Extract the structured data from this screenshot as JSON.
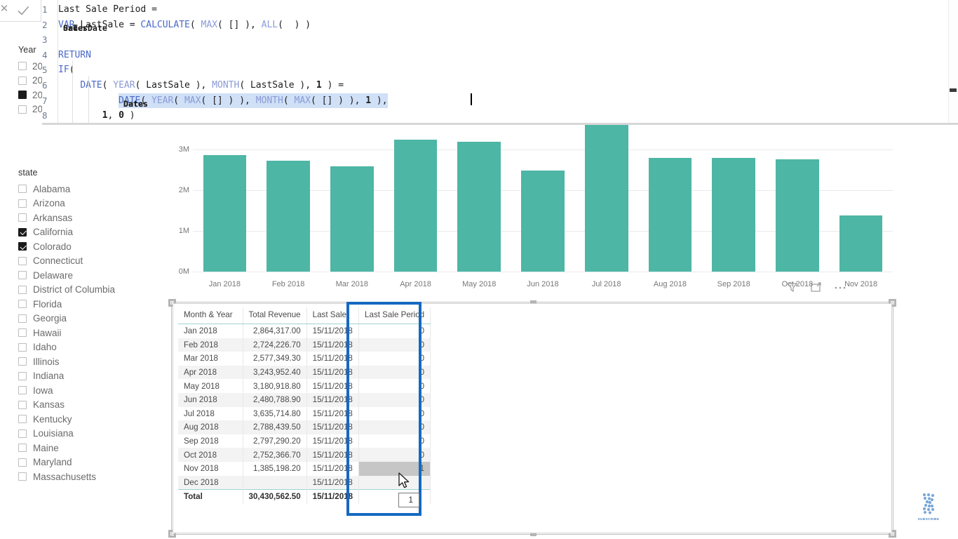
{
  "app": {
    "name": "Power BI Desktop",
    "accent_teal": "#4DB6A5",
    "annotation_blue": "#1669c1"
  },
  "formula_bar": {
    "cancel_icon": "x-icon",
    "commit_icon": "checkmark-icon",
    "measure_name": "Last Sale Period",
    "lines": [
      {
        "n": "1",
        "text": "Last Sale Period ="
      },
      {
        "n": "2",
        "text": "VAR LastSale = CALCULATE( MAX( Sales[OrderDate] ), ALL( Sales ) )"
      },
      {
        "n": "3",
        "text": ""
      },
      {
        "n": "4",
        "text": "RETURN"
      },
      {
        "n": "5",
        "text": "IF("
      },
      {
        "n": "6",
        "text": "    DATE( YEAR( LastSale ), MONTH( LastSale ), 1 ) ="
      },
      {
        "n": "7",
        "text": "    DATE( YEAR( MAX( Dates[Date] ) ), MONTH( MAX( Dates[Date] ) ), 1 ),"
      },
      {
        "n": "8",
        "text": "        1, 0 )"
      }
    ],
    "selected_line": "7"
  },
  "year_slicer": {
    "title": "Year",
    "items": [
      {
        "label": "20",
        "checked": false
      },
      {
        "label": "20",
        "checked": false
      },
      {
        "label": "20",
        "checked": true
      },
      {
        "label": "20",
        "checked": false
      }
    ]
  },
  "state_slicer": {
    "title": "state",
    "items": [
      {
        "label": "Alabama",
        "checked": false
      },
      {
        "label": "Arizona",
        "checked": false
      },
      {
        "label": "Arkansas",
        "checked": false
      },
      {
        "label": "California",
        "checked": true
      },
      {
        "label": "Colorado",
        "checked": true
      },
      {
        "label": "Connecticut",
        "checked": false
      },
      {
        "label": "Delaware",
        "checked": false
      },
      {
        "label": "District of Columbia",
        "checked": false
      },
      {
        "label": "Florida",
        "checked": false
      },
      {
        "label": "Georgia",
        "checked": false
      },
      {
        "label": "Hawaii",
        "checked": false
      },
      {
        "label": "Idaho",
        "checked": false
      },
      {
        "label": "Illinois",
        "checked": false
      },
      {
        "label": "Indiana",
        "checked": false
      },
      {
        "label": "Iowa",
        "checked": false
      },
      {
        "label": "Kansas",
        "checked": false
      },
      {
        "label": "Kentucky",
        "checked": false
      },
      {
        "label": "Louisiana",
        "checked": false
      },
      {
        "label": "Maine",
        "checked": false
      },
      {
        "label": "Maryland",
        "checked": false
      },
      {
        "label": "Massachusetts",
        "checked": false
      }
    ]
  },
  "chart_data": {
    "type": "bar",
    "title": "",
    "xlabel": "",
    "ylabel": "",
    "grid": true,
    "legend": "none",
    "ylim": [
      0,
      3600000
    ],
    "ytick_labels": [
      "0M",
      "1M",
      "2M",
      "3M"
    ],
    "ytick_values": [
      0,
      1000000,
      2000000,
      3000000
    ],
    "categories": [
      "Jan 2018",
      "Feb 2018",
      "Mar 2018",
      "Apr 2018",
      "May 2018",
      "Jun 2018",
      "Jul 2018",
      "Aug 2018",
      "Sep 2018",
      "Oct 2018",
      "Nov 2018"
    ],
    "values": [
      2864317.0,
      2724226.7,
      2577349.3,
      3243952.4,
      3180918.8,
      2480788.9,
      3635714.8,
      2788439.5,
      2797290.2,
      2752366.7,
      1385198.2
    ],
    "bar_color": "#4DB6A5"
  },
  "chart_footer_icons": [
    {
      "name": "filter-icon",
      "glyph": "funnel"
    },
    {
      "name": "focus-mode-icon",
      "glyph": "expand"
    },
    {
      "name": "more-options-icon",
      "glyph": "ellipsis"
    }
  ],
  "table": {
    "columns": [
      "Month & Year",
      "Total Revenue",
      "Last Sale",
      "Last Sale Period"
    ],
    "rows": [
      {
        "month": "Jan 2018",
        "revenue": "2,864,317.00",
        "last_sale": "15/11/2018",
        "period": "0"
      },
      {
        "month": "Feb 2018",
        "revenue": "2,724,226.70",
        "last_sale": "15/11/2018",
        "period": "0"
      },
      {
        "month": "Mar 2018",
        "revenue": "2,577,349.30",
        "last_sale": "15/11/2018",
        "period": "0"
      },
      {
        "month": "Apr 2018",
        "revenue": "3,243,952.40",
        "last_sale": "15/11/2018",
        "period": "0"
      },
      {
        "month": "May 2018",
        "revenue": "3,180,918.80",
        "last_sale": "15/11/2018",
        "period": "0"
      },
      {
        "month": "Jun 2018",
        "revenue": "2,480,788.90",
        "last_sale": "15/11/2018",
        "period": "0"
      },
      {
        "month": "Jul 2018",
        "revenue": "3,635,714.80",
        "last_sale": "15/11/2018",
        "period": "0"
      },
      {
        "month": "Aug 2018",
        "revenue": "2,788,439.50",
        "last_sale": "15/11/2018",
        "period": "0"
      },
      {
        "month": "Sep 2018",
        "revenue": "2,797,290.20",
        "last_sale": "15/11/2018",
        "period": "0"
      },
      {
        "month": "Oct 2018",
        "revenue": "2,752,366.70",
        "last_sale": "15/11/2018",
        "period": "0"
      },
      {
        "month": "Nov 2018",
        "revenue": "1,385,198.20",
        "last_sale": "15/11/2018",
        "period": "1",
        "highlight": true
      },
      {
        "month": "Dec 2018",
        "revenue": "",
        "last_sale": "15/11/2018",
        "period": ""
      }
    ],
    "total": {
      "month": "Total",
      "revenue": "30,430,562.50",
      "last_sale": "15/11/2018",
      "period": ""
    },
    "total_tooltip_value": "1"
  },
  "watermark": {
    "label": "SUBSCRIBE",
    "icon": "helix-logo"
  }
}
